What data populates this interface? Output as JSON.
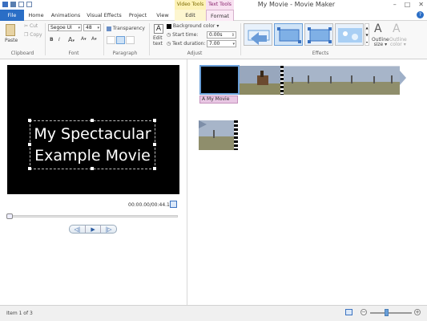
{
  "window": {
    "title": "My Movie - Movie Maker",
    "context_video": "Video Tools",
    "context_text": "Text Tools",
    "min": "–",
    "max": "□",
    "close": "✕"
  },
  "tabs": {
    "file": "File",
    "home": "Home",
    "animations": "Animations",
    "visual_effects": "Visual Effects",
    "project": "Project",
    "view": "View",
    "edit": "Edit",
    "format": "Format"
  },
  "ribbon": {
    "paste": "Paste",
    "cut": "Cut",
    "copy": "Copy",
    "clipboard": "Clipboard",
    "font_name": "Segoe UI",
    "font_size": "48",
    "bold": "B",
    "italic": "I",
    "font_label": "Font",
    "transparency": "Transparency",
    "paragraph": "Paragraph",
    "edit_text_1": "Edit",
    "edit_text_2": "text",
    "background_color": "Background color",
    "start_time_label": "Start time:",
    "start_time_value": "0.00s",
    "text_duration_label": "Text duration:",
    "text_duration_value": "7.00",
    "adjust": "Adjust",
    "effects": "Effects",
    "outline_size_1": "Outline",
    "outline_size_2": "size",
    "outline_color_1": "Outline",
    "outline_color_2": "color"
  },
  "preview": {
    "line1": "My Spectacular",
    "line2": "Example Movie",
    "time": "00:00.00/00:44.13"
  },
  "storyboard": {
    "caption": "My Movie"
  },
  "status": {
    "item": "Item 1 of 3"
  }
}
